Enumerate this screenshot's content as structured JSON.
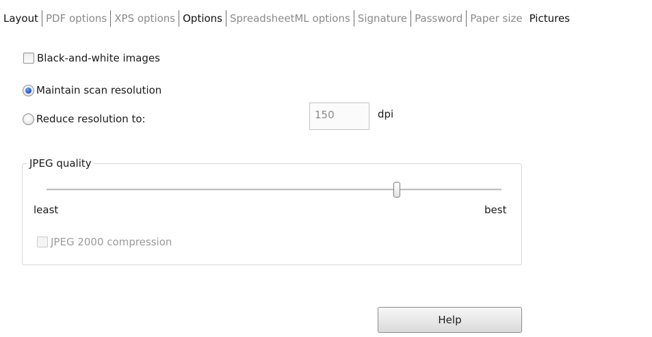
{
  "tabs": [
    {
      "label": "Layout",
      "active": true
    },
    {
      "label": "PDF options",
      "active": false
    },
    {
      "label": "XPS options",
      "active": false
    },
    {
      "label": "Options",
      "active": true
    },
    {
      "label": "SpreadsheetML options",
      "active": false
    },
    {
      "label": "Signature",
      "active": false
    },
    {
      "label": "Password",
      "active": false
    },
    {
      "label": "Paper size",
      "active": false
    },
    {
      "label": "Pictures",
      "active": true
    }
  ],
  "black_white": {
    "label": "Black-and-white images",
    "checked": false
  },
  "resolution": {
    "maintain_label": "Maintain scan resolution",
    "reduce_label": "Reduce resolution to:",
    "selected": "maintain",
    "value": "150",
    "unit": "dpi"
  },
  "jpeg": {
    "title": "JPEG quality",
    "least": "least",
    "best": "best",
    "level": 0.77,
    "jpeg2000_label": "JPEG 2000 compression",
    "jpeg2000_checked": false,
    "jpeg2000_enabled": false
  },
  "help_button": "Help"
}
